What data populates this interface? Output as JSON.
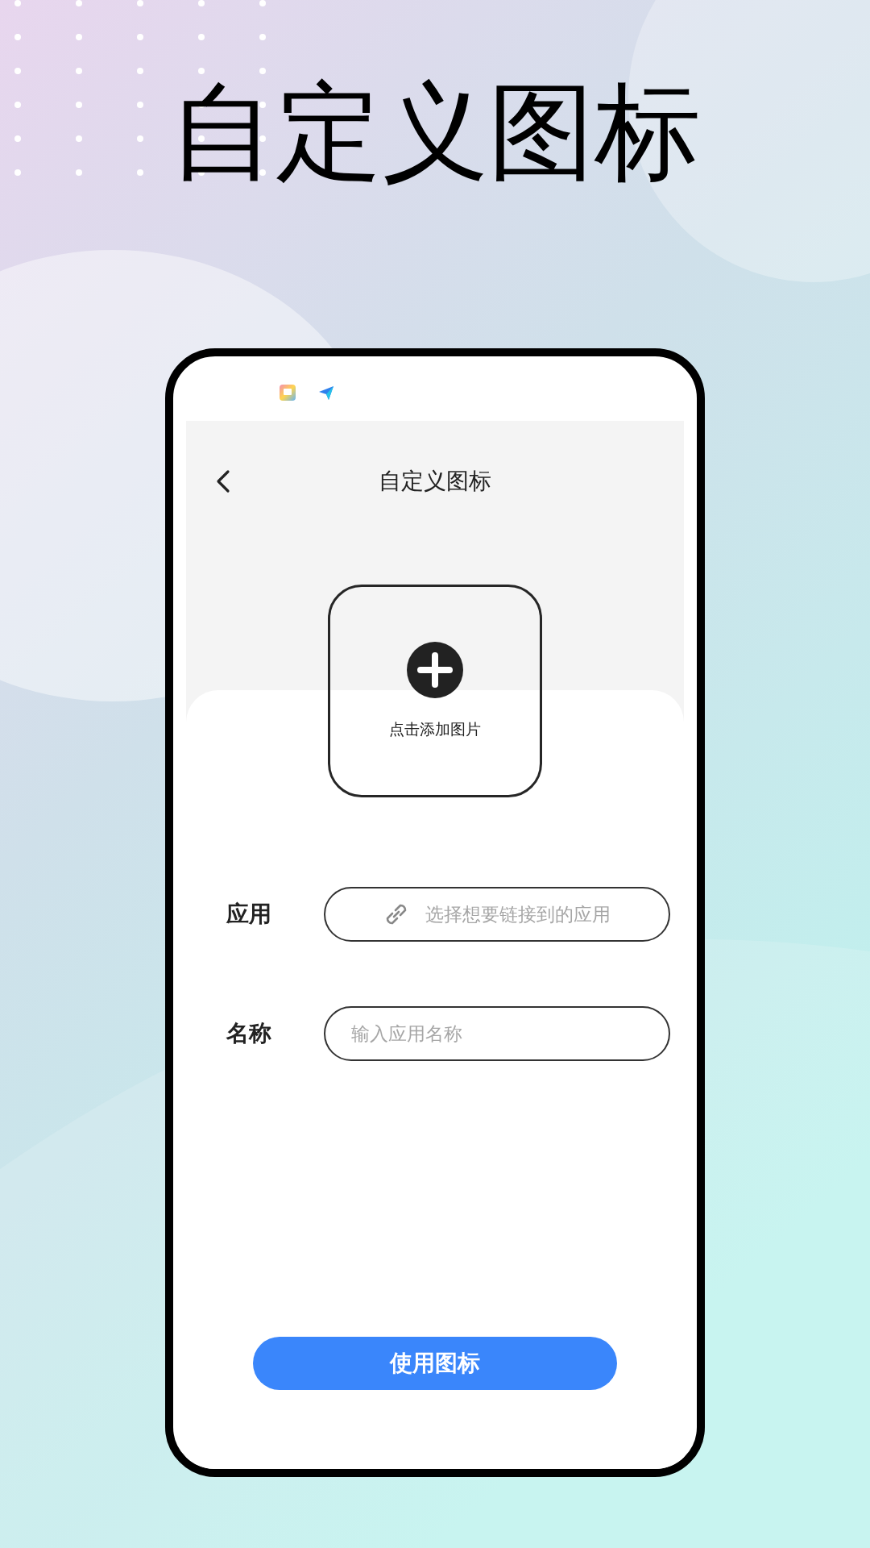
{
  "headline": "自定义图标",
  "screen": {
    "title": "自定义图标",
    "image_picker": {
      "label": "点击添加图片"
    },
    "fields": [
      {
        "label": "应用",
        "placeholder": "选择想要链接到的应用",
        "kind": "link"
      },
      {
        "label": "名称",
        "placeholder": "输入应用名称",
        "kind": "text"
      }
    ],
    "button": "使用图标"
  }
}
